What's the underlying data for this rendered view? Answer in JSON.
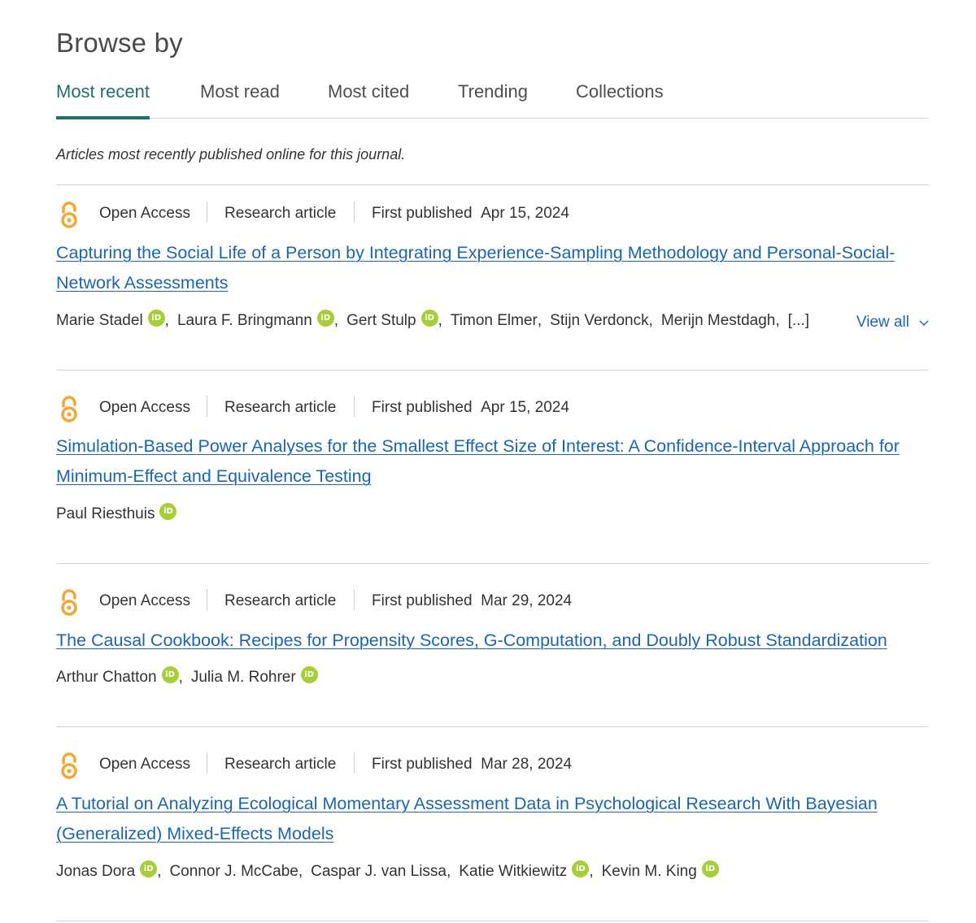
{
  "page": {
    "title": "Browse by",
    "subtitle": "Articles most recently published online for this journal."
  },
  "tabs": [
    {
      "label": "Most recent",
      "active": true
    },
    {
      "label": "Most read",
      "active": false
    },
    {
      "label": "Most cited",
      "active": false
    },
    {
      "label": "Trending",
      "active": false
    },
    {
      "label": "Collections",
      "active": false
    }
  ],
  "colors": {
    "accent": "#1f6f6a",
    "link": "#1a66b0",
    "open_access": "#f4a733",
    "orcid": "#a6ce39"
  },
  "articles": [
    {
      "access": "Open Access",
      "type": "Research article",
      "published_label": "First published",
      "date": "Apr 15, 2024",
      "title": "Capturing the Social Life of a Person by Integrating Experience-Sampling Methodology and Personal-Social-Network Assessments",
      "authors": [
        {
          "name": "Marie Stadel",
          "orcid": true
        },
        {
          "name": "Laura F. Bringmann",
          "orcid": true
        },
        {
          "name": "Gert Stulp",
          "orcid": true
        },
        {
          "name": "Timon Elmer",
          "orcid": false
        },
        {
          "name": "Stijn Verdonck",
          "orcid": false
        },
        {
          "name": "Merijn Mestdagh",
          "orcid": false
        }
      ],
      "more": "[...]",
      "view_all": "View all"
    },
    {
      "access": "Open Access",
      "type": "Research article",
      "published_label": "First published",
      "date": "Apr 15, 2024",
      "title": "Simulation-Based Power Analyses for the Smallest Effect Size of Interest: A Confidence-Interval Approach for Minimum-Effect and Equivalence Testing",
      "authors": [
        {
          "name": "Paul Riesthuis",
          "orcid": true
        }
      ]
    },
    {
      "access": "Open Access",
      "type": "Research article",
      "published_label": "First published",
      "date": "Mar 29, 2024",
      "title": "The Causal Cookbook: Recipes for Propensity Scores, G-Computation, and Doubly Robust Standardization",
      "authors": [
        {
          "name": "Arthur Chatton",
          "orcid": true
        },
        {
          "name": "Julia M. Rohrer",
          "orcid": true
        }
      ]
    },
    {
      "access": "Open Access",
      "type": "Research article",
      "published_label": "First published",
      "date": "Mar 28, 2024",
      "title": "A Tutorial on Analyzing Ecological Momentary Assessment Data in Psychological Research With Bayesian (Generalized) Mixed-Effects Models",
      "authors": [
        {
          "name": "Jonas Dora",
          "orcid": true
        },
        {
          "name": "Connor J. McCabe",
          "orcid": false
        },
        {
          "name": "Caspar J. van Lissa",
          "orcid": false
        },
        {
          "name": "Katie Witkiewitz",
          "orcid": true
        },
        {
          "name": "Kevin M. King",
          "orcid": true
        }
      ]
    }
  ]
}
